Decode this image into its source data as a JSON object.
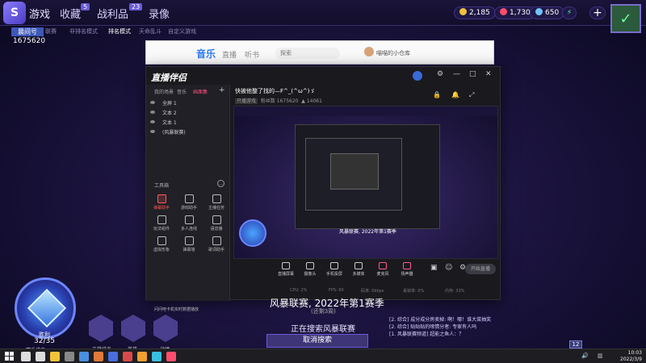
{
  "game": {
    "nav": [
      "游戏",
      "收藏",
      "战利品",
      "录像"
    ],
    "nav_counts": [
      "5",
      "23"
    ],
    "sub_nav": [
      "联赛",
      "非排名模式",
      "排名模式",
      "天命乱斗",
      "自定义游戏"
    ],
    "player_badge": "晨间号",
    "player_id": "1675620",
    "resources": [
      "2,185",
      "1,730",
      "650"
    ],
    "season_title": "风暴联赛, 2022年第1赛季",
    "season_sub": "(还剩3周)",
    "searching": "正在搜索风暴联赛",
    "cancel_label": "取消搜索",
    "chat": [
      "[2. 综合] 成分成分房卖掉: 啊！哪！谁大菜抽奖",
      "[2. 综合] 贴贴贴的嗦情分者: 专家有人吗",
      "[1. 风暴联赛频道] 超能之鱼人：？"
    ],
    "rank_label": "胜利",
    "rank_score": "32/35",
    "rank_sub": "赛季排名",
    "hex_labels": [
      "天梯排名",
      "英雄",
      "战绩"
    ],
    "tray_count": "12"
  },
  "browser": {
    "brand": "音乐",
    "tabs": [
      "直播",
      "听书",
      "探索"
    ],
    "user": "喵喵的小仓库"
  },
  "app": {
    "title": "直播伴侣",
    "left_tabs": [
      "我的场景",
      "音乐",
      "画面集"
    ],
    "scenes": [
      "全屏 1",
      "文本 2",
      "文本 1",
      "(风暴联赛)"
    ],
    "tools_label": "工具箱",
    "tools": [
      "弹幕助手",
      "游戏助手",
      "主播任务",
      "玩法组件",
      "多人连线",
      "语音播",
      "虚拟形象",
      "弹幕墙",
      "歌词助手"
    ],
    "stream_title": "快被他整了找的—F^_(^ω^)ゞ",
    "stream_meta_left": "只播游戏",
    "stream_meta_mid": "粉丝数 1675620",
    "stream_meta_right": "14061",
    "preview_caption": "风暴联赛, 2022年第1赛季",
    "bottom_tools": [
      "直播屏幕",
      "摄像头",
      "手机投屏",
      "多媒体",
      "麦克风",
      "扬声器"
    ],
    "go_live": "开始直播",
    "status": [
      "CPU: 2%",
      "FPS: 60",
      "码率: 0kbps",
      "丢帧率: 0%",
      "内存: 33%"
    ],
    "report": "问问吧卡机实时数据播放"
  },
  "taskbar": {
    "time": "10:03",
    "date": "2022/3/9"
  },
  "colors": {
    "accent": "#6a5bd6",
    "live_red": "#ff5a5a"
  }
}
